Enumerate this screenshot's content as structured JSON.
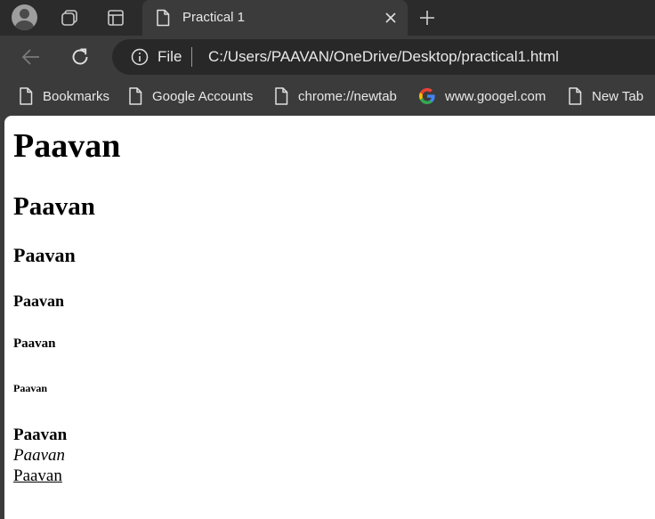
{
  "tab": {
    "title": "Practical 1"
  },
  "omnibox": {
    "scheme_label": "File",
    "url": "C:/Users/PAAVAN/OneDrive/Desktop/practical1.html"
  },
  "bookmarks": [
    {
      "label": "Bookmarks",
      "icon": "page-icon"
    },
    {
      "label": "Google Accounts",
      "icon": "page-icon"
    },
    {
      "label": "chrome://newtab",
      "icon": "page-icon"
    },
    {
      "label": "www.googel.com",
      "icon": "google-g-icon"
    },
    {
      "label": "New Tab",
      "icon": "page-icon"
    }
  ],
  "page": {
    "h1": "Paavan",
    "h2": "Paavan",
    "h3": "Paavan",
    "h4": "Paavan",
    "h5": "Paavan",
    "h6": "Paavan",
    "bold": "Paavan",
    "italic": "Paavan",
    "underline": "Paavan"
  },
  "colors": {
    "tabstrip": "#2b2b2b",
    "toolbar": "#3b3b3b",
    "omnibox": "#282828",
    "text_light": "#e8e8e8",
    "page_bg": "#ffffff"
  }
}
